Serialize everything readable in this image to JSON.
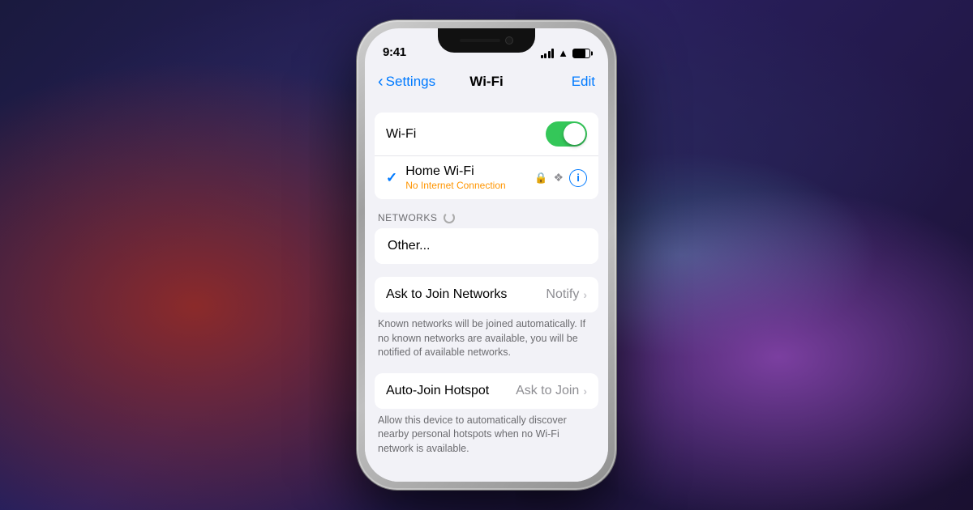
{
  "background": {
    "colors": [
      "#1a1a3e",
      "#8b2a2a",
      "#7b3fa0",
      "#4a7a9b"
    ]
  },
  "status_bar": {
    "time": "9:41",
    "signal_bars": 4,
    "wifi": true,
    "battery_level": 75
  },
  "navigation": {
    "back_label": "Settings",
    "title": "Wi-Fi",
    "edit_label": "Edit"
  },
  "wifi_toggle": {
    "label": "Wi-Fi",
    "enabled": true
  },
  "connected_network": {
    "name": "Home Wi-Fi",
    "status": "No Internet Connection",
    "has_lock": true,
    "has_airplay": true
  },
  "networks_section": {
    "header": "NETWORKS",
    "loading": true,
    "other_label": "Other..."
  },
  "ask_to_join": {
    "label": "Ask to Join Networks",
    "value": "Notify",
    "description": "Known networks will be joined automatically. If no known networks are available, you will be notified of available networks."
  },
  "auto_join_hotspot": {
    "label": "Auto-Join Hotspot",
    "value": "Ask to Join",
    "description": "Allow this device to automatically discover nearby personal hotspots when no Wi-Fi network is available."
  }
}
